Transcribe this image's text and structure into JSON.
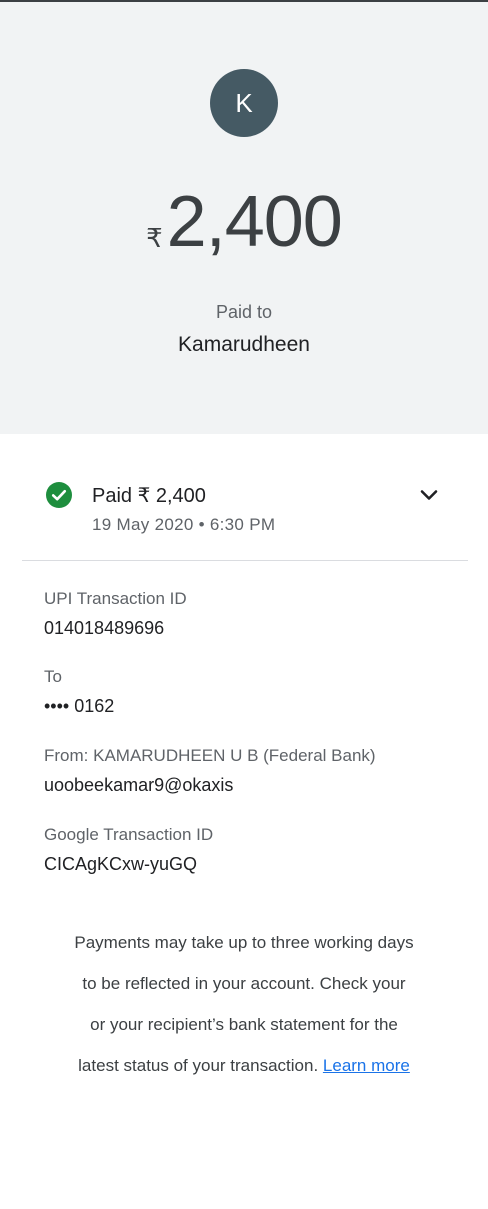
{
  "header": {
    "avatar_initial": "K",
    "currency_symbol": "₹",
    "amount": "2,400",
    "paid_to_label": "Paid to",
    "payee_name": "Kamarudheen"
  },
  "status": {
    "title": "Paid ₹ 2,400",
    "datetime": "19 May 2020 • 6:30 PM",
    "icon": "check-circle-icon",
    "color": "#1e8e3e"
  },
  "details": [
    {
      "label": "UPI Transaction ID",
      "value": "014018489696"
    },
    {
      "label": "To",
      "value": "•••• 0162"
    },
    {
      "label": "From: KAMARUDHEEN U B (Federal Bank)",
      "value": "uoobeekamar9@okaxis"
    },
    {
      "label": "Google Transaction ID",
      "value": "CICAgKCxw-yuGQ"
    }
  ],
  "notice": {
    "text": "Payments may take up to three working days to be reflected in your account. Check your or your recipient’s bank statement for the latest status of your transaction.",
    "link_text": "Learn more"
  },
  "colors": {
    "header_bg": "#f1f3f4",
    "avatar_bg": "#455a64",
    "link": "#1a73e8"
  }
}
